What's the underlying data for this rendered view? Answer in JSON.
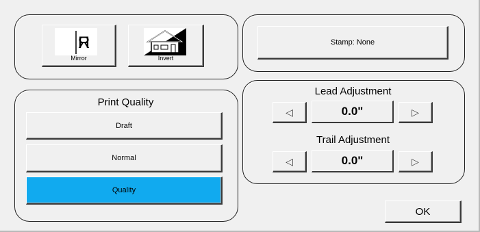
{
  "mirror": {
    "label": "Mirror",
    "icon": "mirror-icon"
  },
  "invert": {
    "label": "Invert",
    "icon": "invert-icon"
  },
  "stamp": {
    "label": "Stamp: None"
  },
  "print_quality": {
    "title": "Print Quality",
    "options": [
      "Draft",
      "Normal",
      "Quality"
    ],
    "selected": "Quality",
    "selected_color": "#11aaef"
  },
  "lead": {
    "title": "Lead Adjustment",
    "value": "0.0\""
  },
  "trail": {
    "title": "Trail Adjustment",
    "value": "0.0\""
  },
  "ok": {
    "label": "OK"
  }
}
